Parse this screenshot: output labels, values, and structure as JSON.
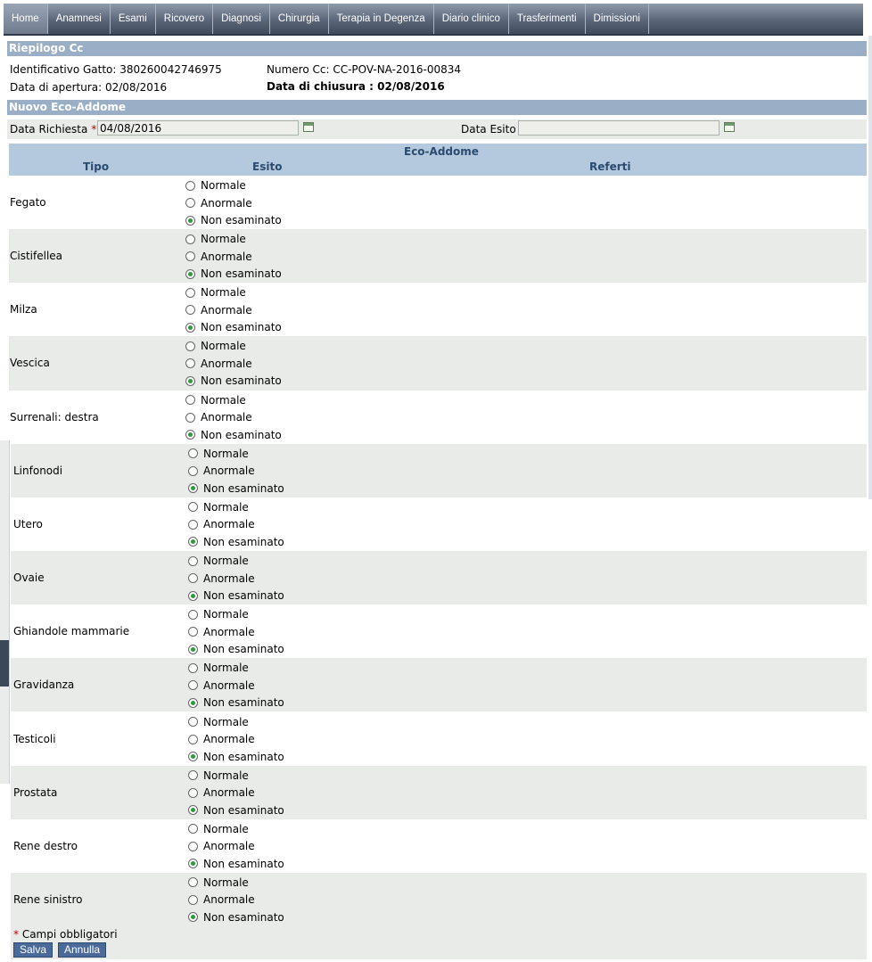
{
  "nav": [
    "Home",
    "Anamnesi",
    "Esami",
    "Ricovero",
    "Diagnosi",
    "Chirurgia",
    "Terapia in Degenza",
    "Diario clinico",
    "Trasferimenti",
    "Dimissioni"
  ],
  "summary": {
    "title": "Riepilogo Cc",
    "id_label": "Identificativo Gatto: 380260042746975",
    "cc_label": "Numero Cc: CC-POV-NA-2016-00834",
    "open_label": "Data di apertura: 02/08/2016",
    "close_label": "Data di chiusura : 02/08/2016"
  },
  "form": {
    "title": "Nuovo Eco-Addome",
    "requested_label": "Data Richiesta",
    "required_mark": "*",
    "requested_value": "04/08/2016",
    "result_label": "Data Esito",
    "result_value": ""
  },
  "table": {
    "caption": "Eco-Addome",
    "col_tipo": "Tipo",
    "col_esito": "Esito",
    "col_referti": "Referti",
    "options": [
      "Normale",
      "Anormale",
      "Non esaminato"
    ],
    "rows": [
      {
        "label": "Fegato",
        "selected": 2
      },
      {
        "label": "Cistifellea",
        "selected": 2
      },
      {
        "label": "Milza",
        "selected": 2
      },
      {
        "label": "Vescica",
        "selected": 2
      },
      {
        "label": "Surrenali: destra",
        "selected": 2
      },
      {
        "label": "Linfonodi",
        "selected": 2
      },
      {
        "label": "Utero",
        "selected": 2
      },
      {
        "label": "Ovaie",
        "selected": 2
      },
      {
        "label": "Ghiandole mammarie",
        "selected": 2
      },
      {
        "label": "Gravidanza",
        "selected": 2
      },
      {
        "label": "Testicoli",
        "selected": 2
      },
      {
        "label": "Prostata",
        "selected": 2
      },
      {
        "label": "Rene destro",
        "selected": 2
      },
      {
        "label": "Rene sinistro",
        "selected": 2
      }
    ]
  },
  "footer": {
    "required_mark": "*",
    "required_note": "Campi obbligatori",
    "save": "Salva",
    "cancel": "Annulla"
  }
}
